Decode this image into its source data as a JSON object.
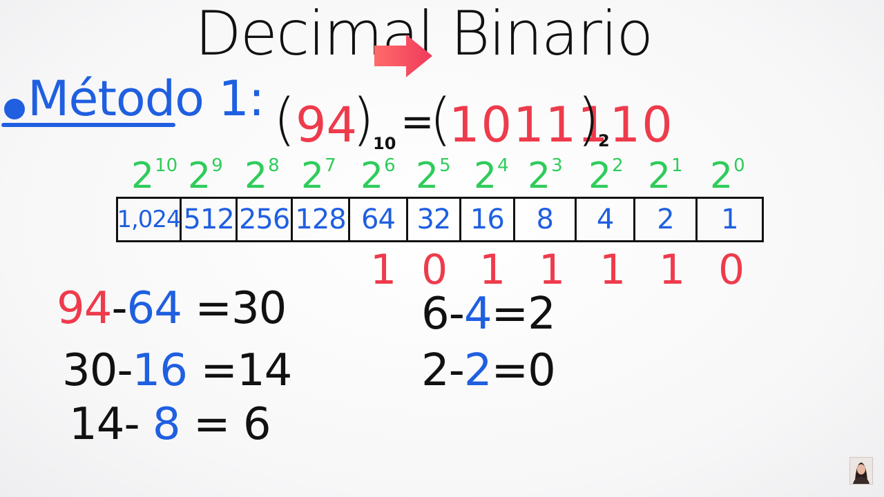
{
  "title": {
    "left": "Decimal",
    "right": "Binario"
  },
  "method": {
    "label": "Método 1:"
  },
  "equation": {
    "open_paren": "(",
    "close_paren": ")",
    "decimal": "94",
    "base10": "10",
    "equals": "=",
    "binary": "1011110",
    "base2": "2"
  },
  "powers": [
    {
      "base": "2",
      "exp": "10"
    },
    {
      "base": "2",
      "exp": "9"
    },
    {
      "base": "2",
      "exp": "8"
    },
    {
      "base": "2",
      "exp": "7"
    },
    {
      "base": "2",
      "exp": "6"
    },
    {
      "base": "2",
      "exp": "5"
    },
    {
      "base": "2",
      "exp": "4"
    },
    {
      "base": "2",
      "exp": "3"
    },
    {
      "base": "2",
      "exp": "2"
    },
    {
      "base": "2",
      "exp": "1"
    },
    {
      "base": "2",
      "exp": "0"
    }
  ],
  "place_values": [
    "1,024",
    "512",
    "256",
    "128",
    "64",
    "32",
    "16",
    "8",
    "4",
    "2",
    "1"
  ],
  "bits": [
    "1",
    "0",
    "1",
    "1",
    "1",
    "1",
    "0"
  ],
  "calculations": [
    {
      "a": "94",
      "op": "-",
      "b": "64",
      "eq": "=",
      "result": "30"
    },
    {
      "a": "30",
      "op": "-",
      "b": "16",
      "eq": "=",
      "result": "14"
    },
    {
      "a": "14",
      "op": "-",
      "b": "8",
      "eq": "=",
      "result": "6"
    },
    {
      "a": "6",
      "op": "-",
      "b": "4",
      "eq": "=",
      "result": "2"
    },
    {
      "a": "2",
      "op": "-",
      "b": "2",
      "eq": "=",
      "result": "0"
    }
  ],
  "colors": {
    "red": "#ee3b4c",
    "blue": "#1f5fe0",
    "green": "#2ecc5a",
    "ink": "#111111"
  }
}
